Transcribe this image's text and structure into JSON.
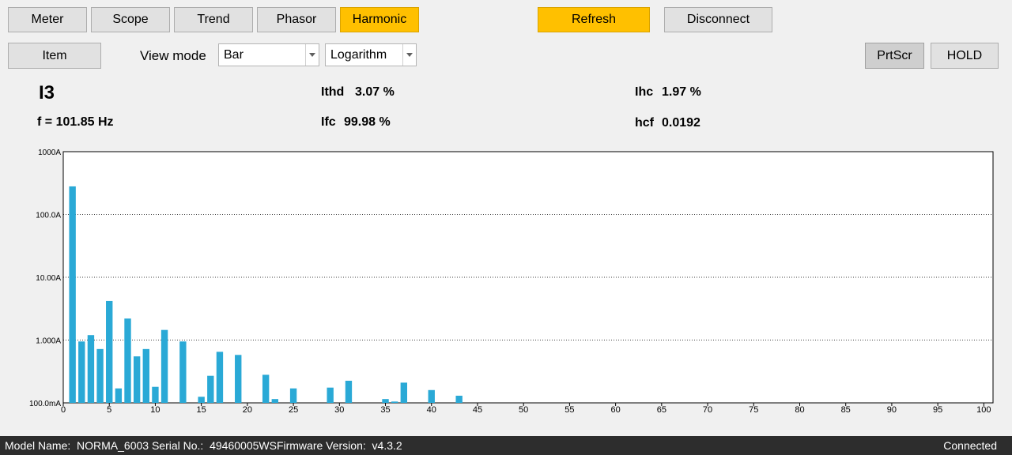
{
  "nav": {
    "meter": "Meter",
    "scope": "Scope",
    "trend": "Trend",
    "phasor": "Phasor",
    "harmonic": "Harmonic"
  },
  "actions": {
    "refresh": "Refresh",
    "disconnect": "Disconnect"
  },
  "toolbar": {
    "item": "Item",
    "view_mode_label": "View mode",
    "view_mode_value": "Bar",
    "scale_value": "Logarithm",
    "prtscr": "PrtScr",
    "hold": "HOLD"
  },
  "colors": {
    "accent": "#ffc000",
    "bar": "#2aa9d6",
    "status_bg": "#2d2d2d"
  },
  "measurement": {
    "channel": "I3",
    "frequency": "f = 101.85 Hz",
    "ithd_label": "Ithd",
    "ithd_value": "3.07 %",
    "ifc_label": "Ifc",
    "ifc_value": "99.98 %",
    "ihc_label": "Ihc",
    "ihc_value": "1.97 %",
    "hcf_label": "hcf",
    "hcf_value": "0.0192"
  },
  "chart_data": {
    "type": "bar",
    "yscale": "log",
    "ylim": [
      0.1,
      1000
    ],
    "xlim": [
      0,
      101
    ],
    "y_ticks": [
      {
        "value": 1000,
        "label": "1000A"
      },
      {
        "value": 100,
        "label": "100.0A"
      },
      {
        "value": 10,
        "label": "10.00A"
      },
      {
        "value": 1,
        "label": "1.000A"
      },
      {
        "value": 0.1,
        "label": "100.0mA"
      }
    ],
    "x_ticks": [
      0,
      5,
      10,
      15,
      20,
      25,
      30,
      35,
      40,
      45,
      50,
      55,
      60,
      65,
      70,
      75,
      80,
      85,
      90,
      95,
      100
    ],
    "grid": true,
    "bars": [
      {
        "x": 1,
        "y": 280
      },
      {
        "x": 2,
        "y": 0.95
      },
      {
        "x": 3,
        "y": 1.2
      },
      {
        "x": 4,
        "y": 0.72
      },
      {
        "x": 5,
        "y": 4.2
      },
      {
        "x": 6,
        "y": 0.17
      },
      {
        "x": 7,
        "y": 2.2
      },
      {
        "x": 8,
        "y": 0.55
      },
      {
        "x": 9,
        "y": 0.72
      },
      {
        "x": 10,
        "y": 0.18
      },
      {
        "x": 11,
        "y": 1.45
      },
      {
        "x": 13,
        "y": 0.95
      },
      {
        "x": 15,
        "y": 0.125
      },
      {
        "x": 16,
        "y": 0.27
      },
      {
        "x": 17,
        "y": 0.65
      },
      {
        "x": 19,
        "y": 0.58
      },
      {
        "x": 22,
        "y": 0.28
      },
      {
        "x": 23,
        "y": 0.115
      },
      {
        "x": 25,
        "y": 0.17
      },
      {
        "x": 29,
        "y": 0.175
      },
      {
        "x": 31,
        "y": 0.225
      },
      {
        "x": 35,
        "y": 0.115
      },
      {
        "x": 36,
        "y": 0.105
      },
      {
        "x": 37,
        "y": 0.21
      },
      {
        "x": 40,
        "y": 0.16
      },
      {
        "x": 43,
        "y": 0.13
      }
    ]
  },
  "status": {
    "device_info": "Model Name:  NORMA_6003 Serial No.:  49460005WSFirmware Version:  v4.3.2",
    "connection": "Connected"
  }
}
